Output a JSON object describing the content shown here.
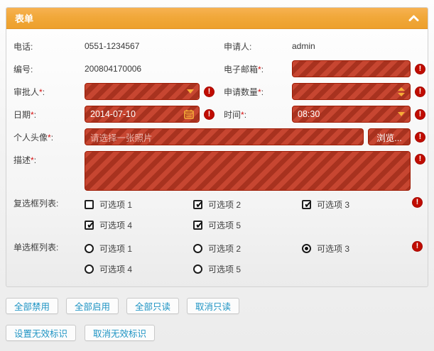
{
  "icons": {
    "check_glyph": "✔",
    "error_glyph": "!"
  },
  "panel": {
    "title": "表单"
  },
  "form": {
    "star": "*",
    "colon": ":",
    "phone": {
      "label": "电话:",
      "value": "0551-1234567"
    },
    "applicant": {
      "label": "申请人:",
      "value": "admin"
    },
    "number": {
      "label": "编号:",
      "value": "200804170006"
    },
    "email": {
      "label": "电子邮箱",
      "value": ""
    },
    "approver": {
      "label": "审批人",
      "value": ""
    },
    "quantity": {
      "label": "申请数量",
      "value": ""
    },
    "date": {
      "label": "日期",
      "value": "2014-07-10"
    },
    "time": {
      "label": "时间",
      "value": "08:30"
    },
    "avatar": {
      "label": "个人头像",
      "placeholder": "请选择一张照片",
      "browse": "浏览..."
    },
    "description": {
      "label": "描述",
      "value": ""
    },
    "checkbox_list": {
      "label": "复选框列表:",
      "options": [
        {
          "label": "可选项 1",
          "checked": false
        },
        {
          "label": "可选项 2",
          "checked": true
        },
        {
          "label": "可选项 3",
          "checked": true
        },
        {
          "label": "可选项 4",
          "checked": true
        },
        {
          "label": "可选项 5",
          "checked": true
        }
      ]
    },
    "radio_list": {
      "label": "单选框列表:",
      "options": [
        {
          "label": "可选项 1",
          "selected": false
        },
        {
          "label": "可选项 2",
          "selected": false
        },
        {
          "label": "可选项 3",
          "selected": true
        },
        {
          "label": "可选项 4",
          "selected": false
        },
        {
          "label": "可选项 5",
          "selected": false
        }
      ]
    }
  },
  "buttons": [
    "全部禁用",
    "全部启用",
    "全部只读",
    "取消只读",
    "设置无效标识",
    "取消无效标识"
  ],
  "colors": {
    "header_orange": "#f1a83a",
    "invalid_red": "#c43a24",
    "invalid_border": "#9e1b04",
    "widget_arrow": "#f6ac38",
    "error_badge": "#c00c00",
    "button_text": "#1e94c4"
  }
}
